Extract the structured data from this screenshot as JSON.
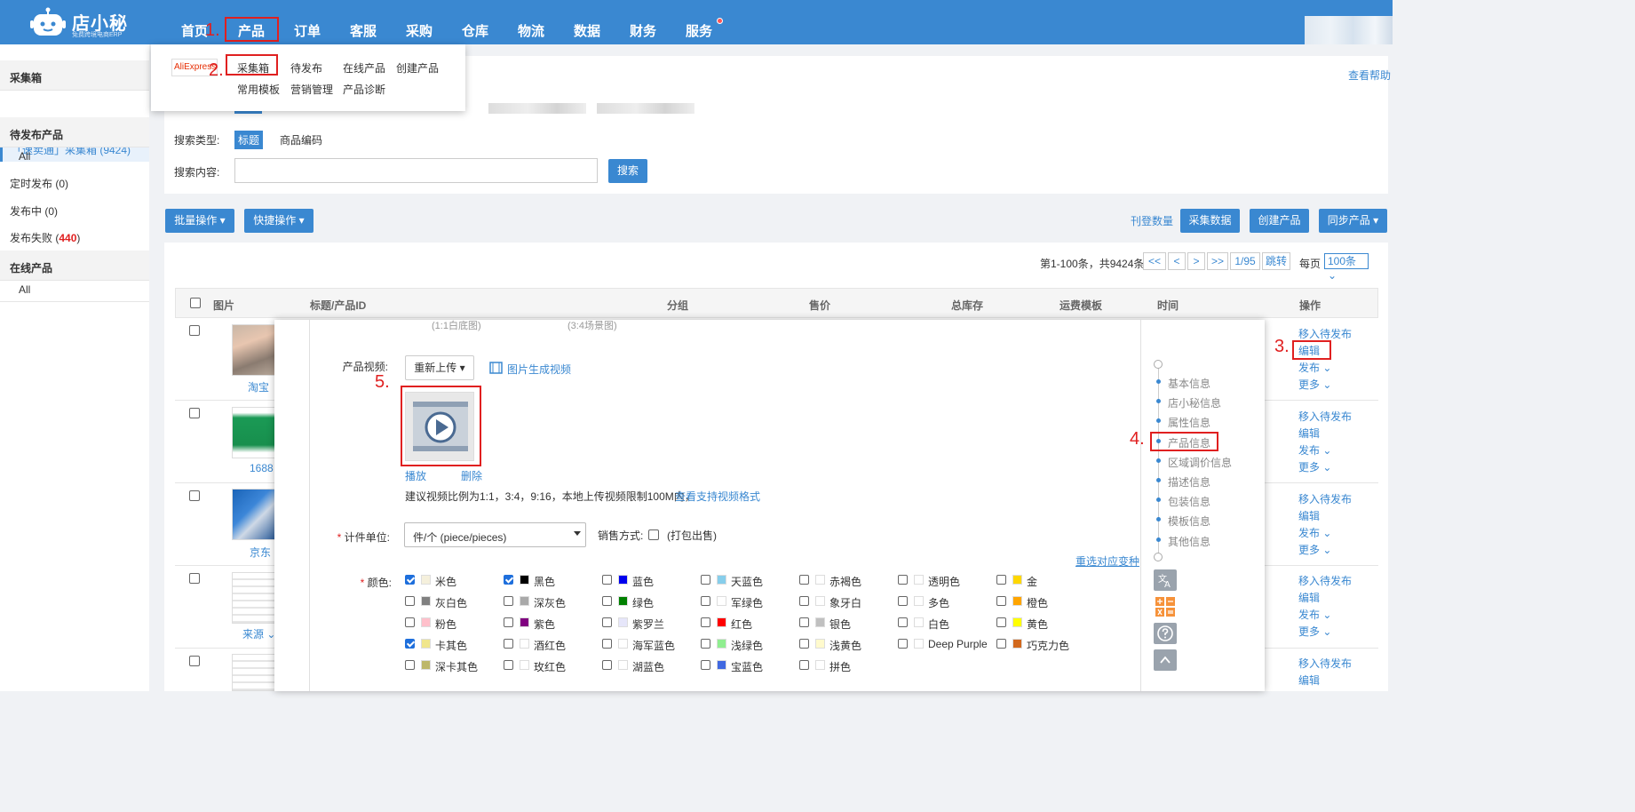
{
  "brand": {
    "name": "店小秘",
    "tagline": "免费跨境电商ERP"
  },
  "topnav": {
    "items": [
      "首页",
      "产品",
      "订单",
      "客服",
      "采购",
      "仓库",
      "物流",
      "数据",
      "财务",
      "服务"
    ]
  },
  "annotations": {
    "a1": "1.",
    "a2": "2.",
    "a3": "3.",
    "a4": "4.",
    "a5": "5."
  },
  "dropdown": {
    "aliexpress": "AliExpress",
    "items_row1": [
      "采集箱",
      "待发布",
      "在线产品",
      "创建产品"
    ],
    "items_row2": [
      "常用模板",
      "营销管理",
      "产品诊断"
    ]
  },
  "sidebar": {
    "collect_head": "采集箱",
    "collect_active": "「速卖通」采集箱 (9424)",
    "pending_head": "待发布产品",
    "pending_all": "All",
    "scheduled": "定时发布 (0)",
    "publishing": "发布中 (0)",
    "failed_prefix": "发布失败 (",
    "failed_count": "440",
    "failed_suffix": ")",
    "online_head": "在线产品",
    "online_all": "All"
  },
  "filter": {
    "help": "查看帮助",
    "search_type_label": "搜索类型:",
    "type_title": "标题",
    "type_code": "商品编码",
    "search_content_label": "搜索内容:",
    "search_value": "",
    "search_button": "搜索"
  },
  "toolbar": {
    "batch": "批量操作",
    "quick": "快捷操作",
    "publish_count": "刊登数量",
    "collect_data": "采集数据",
    "create_product": "创建产品",
    "sync_product": "同步产品"
  },
  "pager": {
    "summary": "第1-100条，共9424条",
    "first": "<<",
    "prev": "<",
    "next": ">",
    "last": ">>",
    "page": "1/95",
    "jump": "跳转",
    "per_page_label": "每页",
    "per_page": "100条"
  },
  "table": {
    "headers": [
      "图片",
      "标题/产品ID",
      "分组",
      "售价",
      "总库存",
      "运费模板",
      "时间",
      "操作"
    ],
    "rows": [
      {
        "source": "淘宝"
      },
      {
        "source": "1688"
      },
      {
        "source": "京东"
      },
      {
        "source": "来源"
      },
      {
        "source": ""
      }
    ],
    "ops": [
      "移入待发布",
      "编辑",
      "发布",
      "更多"
    ]
  },
  "modal": {
    "note1": "(1:1白底图)",
    "note2": "(3:4场景图)",
    "video_label": "产品视频:",
    "reupload": "重新上传",
    "gen_video": "图片生成视频",
    "play": "播放",
    "delete": "删除",
    "video_hint": "建议视频比例为1:1，3:4，9:16，本地上传视频限制100M内，",
    "video_formats": "查看支持视频格式",
    "unit_label": "计件单位:",
    "unit_value": "件/个 (piece/pieces)",
    "sale_label": "销售方式:",
    "sale_option": "(打包出售)",
    "reselect": "重选对应变种",
    "color_label": "颜色:",
    "colors": [
      {
        "name": "米色",
        "hex": "#f5f0dc",
        "checked": true
      },
      {
        "name": "黑色",
        "hex": "#000000",
        "checked": true
      },
      {
        "name": "蓝色",
        "hex": "#0000ee",
        "checked": false
      },
      {
        "name": "天蓝色",
        "hex": "#87ceeb",
        "checked": false
      },
      {
        "name": "赤褐色",
        "hex": "#ffffff",
        "checked": false
      },
      {
        "name": "透明色",
        "hex": "#ffffff",
        "checked": false
      },
      {
        "name": "金",
        "hex": "#ffd700",
        "checked": false
      },
      {
        "name": "灰白色",
        "hex": "#808080",
        "checked": false
      },
      {
        "name": "深灰色",
        "hex": "#a9a9a9",
        "checked": false
      },
      {
        "name": "绿色",
        "hex": "#008000",
        "checked": false
      },
      {
        "name": "军绿色",
        "hex": "#ffffff",
        "checked": false
      },
      {
        "name": "象牙白",
        "hex": "#ffffff",
        "checked": false
      },
      {
        "name": "多色",
        "hex": "#ffffff",
        "checked": false
      },
      {
        "name": "橙色",
        "hex": "#ffa500",
        "checked": false
      },
      {
        "name": "粉色",
        "hex": "#ffc0cb",
        "checked": false
      },
      {
        "name": "紫色",
        "hex": "#800080",
        "checked": false
      },
      {
        "name": "紫罗兰",
        "hex": "#e6e6fa",
        "checked": false
      },
      {
        "name": "红色",
        "hex": "#ff0000",
        "checked": false
      },
      {
        "name": "银色",
        "hex": "#c0c0c0",
        "checked": false
      },
      {
        "name": "白色",
        "hex": "#ffffff",
        "checked": false
      },
      {
        "name": "黄色",
        "hex": "#ffff00",
        "checked": false
      },
      {
        "name": "卡其色",
        "hex": "#f0e68c",
        "checked": true
      },
      {
        "name": "酒红色",
        "hex": "#ffffff",
        "checked": false
      },
      {
        "name": "海军蓝色",
        "hex": "#ffffff",
        "checked": false
      },
      {
        "name": "浅绿色",
        "hex": "#90ee90",
        "checked": false
      },
      {
        "name": "浅黄色",
        "hex": "#fffacd",
        "checked": false
      },
      {
        "name": "Deep Purple",
        "hex": "#ffffff",
        "checked": false
      },
      {
        "name": "巧克力色",
        "hex": "#d2691e",
        "checked": false
      },
      {
        "name": "深卡其色",
        "hex": "#bdb76b",
        "checked": false
      },
      {
        "name": "玫红色",
        "hex": "#ffffff",
        "checked": false
      },
      {
        "name": "湖蓝色",
        "hex": "#ffffff",
        "checked": false
      },
      {
        "name": "宝蓝色",
        "hex": "#4169e1",
        "checked": false
      },
      {
        "name": "拼色",
        "hex": "#ffffff",
        "checked": false
      }
    ],
    "steps": [
      "基本信息",
      "店小秘信息",
      "属性信息",
      "产品信息",
      "区域调价信息",
      "描述信息",
      "包装信息",
      "模板信息",
      "其他信息"
    ]
  }
}
